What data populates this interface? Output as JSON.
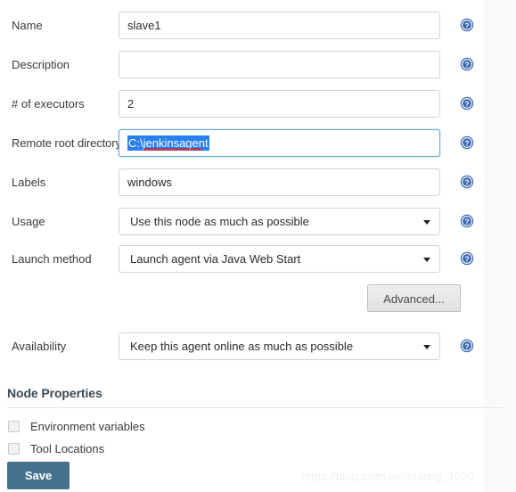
{
  "form": {
    "fields": [
      {
        "label": "Name",
        "type": "text",
        "value": "slave1",
        "placeholder": "",
        "name": "name",
        "focused": false,
        "help": true
      },
      {
        "label": "Description",
        "type": "text",
        "value": "",
        "placeholder": "",
        "name": "description",
        "focused": false,
        "help": true
      },
      {
        "label": "# of executors",
        "type": "text",
        "value": "2",
        "placeholder": "",
        "name": "executors",
        "focused": false,
        "help": true
      },
      {
        "label": "Remote root directory",
        "type": "text-selected",
        "value": "C:\\jenkinsagent",
        "placeholder": "",
        "name": "remote-root-directory",
        "focused": true,
        "help": true
      },
      {
        "label": "Labels",
        "type": "text",
        "value": "windows",
        "placeholder": "",
        "name": "labels",
        "focused": false,
        "help": true
      },
      {
        "label": "Usage",
        "type": "select",
        "value": "Use this node as much as possible",
        "name": "usage",
        "help": true
      },
      {
        "label": "Launch method",
        "type": "select",
        "value": "Launch agent via Java Web Start",
        "name": "launch-method",
        "help": true
      },
      {
        "label": "Availability",
        "type": "select",
        "value": "Keep this agent online as much as possible",
        "name": "availability",
        "help": true
      }
    ],
    "advanced_button": "Advanced...",
    "save_button": "Save"
  },
  "node_properties": {
    "title": "Node Properties",
    "checkboxes": [
      {
        "label": "Environment variables",
        "checked": false,
        "name": "environment-variables"
      },
      {
        "label": "Tool Locations",
        "checked": false,
        "name": "tool-locations"
      }
    ]
  },
  "watermark": "https://blog.csdn.net/cuiting_1020",
  "icons": {
    "help": "help-icon",
    "dropdown": "chevron-down-icon"
  },
  "colors": {
    "save_button": "#46728e",
    "focus_border": "#66a6e0",
    "selection": "#2a7ff0",
    "help_icon": "#3a66b0",
    "section_title": "#3b4a54"
  }
}
